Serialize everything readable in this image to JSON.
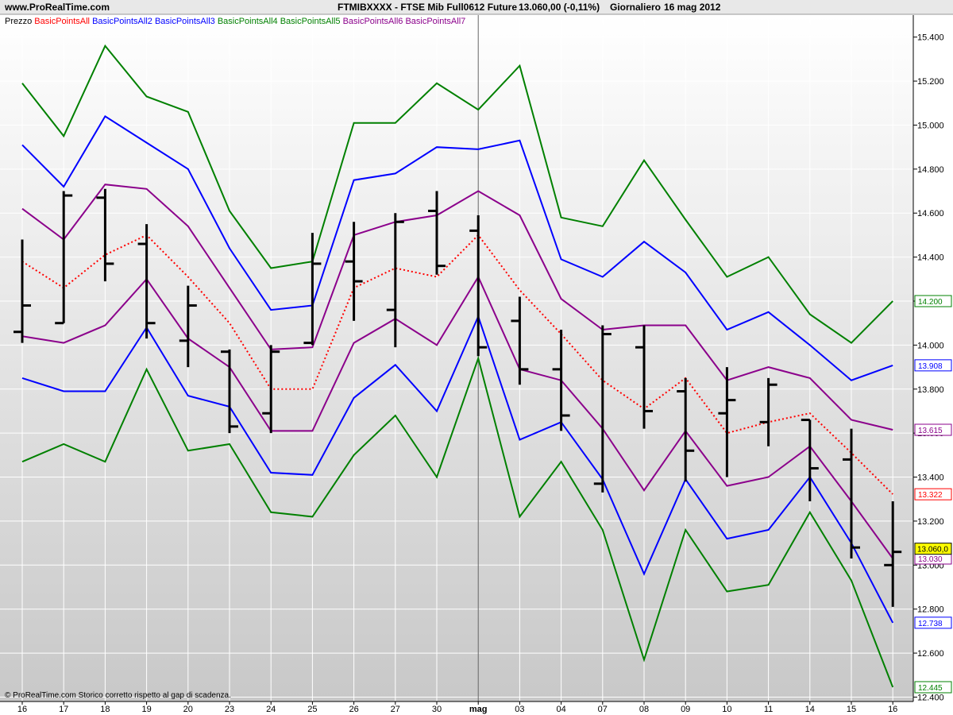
{
  "header": {
    "site": "www.ProRealTime.com",
    "instrument": "FTMIBXXXX - FTSE Mib Full0612 Future",
    "last_price": "13.060,00 (-0,11%)",
    "period": "Giornaliero",
    "date": "16 mag 2012"
  },
  "footer": {
    "note": "© ProRealTime.com  Storico corretto rispetto al gap di scadenza."
  },
  "colors": {
    "background_top": "#ffffff",
    "background_bottom": "#c8c8c8",
    "red": "#ff0000",
    "blue": "#0000ff",
    "green": "#008000",
    "purple": "#8b008b",
    "bars": "#000000",
    "last_price_bg": "#ffff00"
  },
  "chart_data": {
    "type": "line",
    "title": "FTMIBXXXX - FTSE Mib Full0612 Future",
    "x": [
      "16",
      "17",
      "18",
      "19",
      "20",
      "23",
      "24",
      "25",
      "26",
      "27",
      "30",
      "mag",
      "03",
      "04",
      "07",
      "08",
      "09",
      "10",
      "11",
      "14",
      "15",
      "16"
    ],
    "ylim": [
      12380,
      15500
    ],
    "yticks": [
      12400,
      12600,
      12800,
      13000,
      13200,
      13400,
      13600,
      13800,
      14000,
      14200,
      14400,
      14600,
      14800,
      15000,
      15200,
      15400
    ],
    "ytick_labels": [
      "12.400",
      "12.600",
      "12.800",
      "13.000",
      "13.200",
      "13.400",
      "13.600",
      "13.800",
      "14.000",
      "14.200",
      "14.400",
      "14.600",
      "14.800",
      "15.000",
      "15.200",
      "15.400"
    ],
    "grid": true,
    "legend_prefix": "Prezzo",
    "legend_position": "top-left",
    "price_bars": [
      {
        "open": 14060,
        "high": 14480,
        "low": 14010,
        "close": 14180
      },
      {
        "open": 14100,
        "high": 14700,
        "low": 14100,
        "close": 14680
      },
      {
        "open": 14670,
        "high": 14710,
        "low": 14290,
        "close": 14370
      },
      {
        "open": 14460,
        "high": 14550,
        "low": 14030,
        "close": 14100
      },
      {
        "open": 14020,
        "high": 14270,
        "low": 13900,
        "close": 14180
      },
      {
        "open": 13970,
        "high": 13980,
        "low": 13600,
        "close": 13630
      },
      {
        "open": 13690,
        "high": 14000,
        "low": 13600,
        "close": 13970
      },
      {
        "open": 14010,
        "high": 14510,
        "low": 14000,
        "close": 14370
      },
      {
        "open": 14380,
        "high": 14560,
        "low": 14110,
        "close": 14290
      },
      {
        "open": 14160,
        "high": 14600,
        "low": 13990,
        "close": 14560
      },
      {
        "open": 14610,
        "high": 14700,
        "low": 14320,
        "close": 14360
      },
      {
        "open": 14520,
        "high": 14590,
        "low": 13950,
        "close": 13990
      },
      {
        "open": 14110,
        "high": 14220,
        "low": 13820,
        "close": 13890
      },
      {
        "open": 13890,
        "high": 14070,
        "low": 13610,
        "close": 13680
      },
      {
        "open": 13370,
        "high": 14090,
        "low": 13330,
        "close": 14050
      },
      {
        "open": 13990,
        "high": 14090,
        "low": 13620,
        "close": 13700
      },
      {
        "open": 13790,
        "high": 13850,
        "low": 13380,
        "close": 13520
      },
      {
        "open": 13690,
        "high": 13900,
        "low": 13400,
        "close": 13750
      },
      {
        "open": 13650,
        "high": 13850,
        "low": 13540,
        "close": 13820
      },
      {
        "open": 13660,
        "high": 13660,
        "low": 13290,
        "close": 13440
      },
      {
        "open": 13480,
        "high": 13620,
        "low": 13030,
        "close": 13080
      },
      {
        "open": 13000,
        "high": 13290,
        "low": 12810,
        "close": 13060
      }
    ],
    "series": [
      {
        "name": "BasicPointsAll",
        "color": "#ff0000",
        "dashed": true,
        "last_label": "13.322",
        "values": [
          14380,
          14260,
          14410,
          14500,
          14310,
          14100,
          13800,
          13800,
          14260,
          14350,
          14310,
          14500,
          14250,
          14050,
          13840,
          13710,
          13850,
          13600,
          13650,
          13690,
          13510,
          13322
        ]
      },
      {
        "name": "BasicPointsAll2",
        "color": "#0000ff",
        "dashed": false,
        "last_label": "13.908",
        "values": [
          14910,
          14720,
          15040,
          14920,
          14800,
          14440,
          14160,
          14180,
          14750,
          14780,
          14900,
          14890,
          14930,
          14390,
          14310,
          14470,
          14330,
          14070,
          14150,
          14000,
          13840,
          13908
        ]
      },
      {
        "name": "BasicPointsAll3",
        "color": "#0000ff",
        "dashed": false,
        "last_label": "12.738",
        "values": [
          13850,
          13790,
          13790,
          14080,
          13770,
          13720,
          13420,
          13410,
          13760,
          13910,
          13700,
          14130,
          13570,
          13650,
          13390,
          12960,
          13390,
          13120,
          13160,
          13400,
          13100,
          12738
        ]
      },
      {
        "name": "BasicPointsAll4",
        "color": "#008000",
        "dashed": false,
        "last_label": "14.200",
        "values": [
          15190,
          14950,
          15360,
          15130,
          15060,
          14610,
          14350,
          14380,
          15010,
          15010,
          15190,
          15070,
          15270,
          14580,
          14540,
          14840,
          14570,
          14310,
          14400,
          14140,
          14010,
          14200
        ]
      },
      {
        "name": "BasicPointsAll5",
        "color": "#008000",
        "dashed": false,
        "last_label": "12.445",
        "values": [
          13470,
          13550,
          13470,
          13890,
          13520,
          13550,
          13240,
          13220,
          13500,
          13680,
          13400,
          13940,
          13220,
          13470,
          13160,
          12570,
          13160,
          12880,
          12910,
          13240,
          12930,
          12445
        ]
      },
      {
        "name": "BasicPointsAll6",
        "color": "#8b008b",
        "dashed": false,
        "last_label": "13.615",
        "values": [
          14620,
          14480,
          14730,
          14710,
          14540,
          14260,
          13980,
          13990,
          14500,
          14560,
          14590,
          14700,
          14590,
          14210,
          14070,
          14090,
          14090,
          13840,
          13900,
          13850,
          13660,
          13615
        ]
      },
      {
        "name": "BasicPointsAll7",
        "color": "#8b008b",
        "dashed": false,
        "last_label": "13.030",
        "values": [
          14040,
          14010,
          14090,
          14300,
          14030,
          13900,
          13610,
          13610,
          14010,
          14120,
          14000,
          14310,
          13890,
          13840,
          13620,
          13340,
          13610,
          13360,
          13400,
          13540,
          13290,
          13030
        ]
      }
    ],
    "last_price_label": "13.060,0"
  }
}
